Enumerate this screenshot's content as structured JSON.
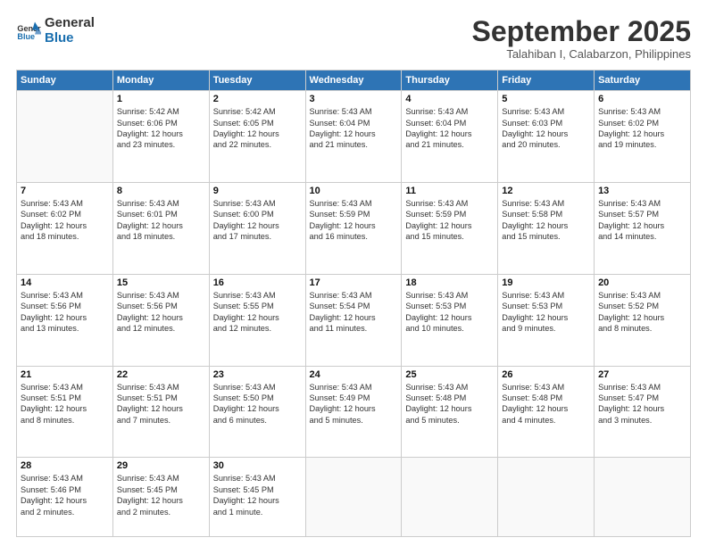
{
  "logo": {
    "line1": "General",
    "line2": "Blue"
  },
  "title": "September 2025",
  "subtitle": "Talahiban I, Calabarzon, Philippines",
  "days": [
    "Sunday",
    "Monday",
    "Tuesday",
    "Wednesday",
    "Thursday",
    "Friday",
    "Saturday"
  ],
  "weeks": [
    [
      {
        "date": "",
        "info": ""
      },
      {
        "date": "1",
        "info": "Sunrise: 5:42 AM\nSunset: 6:06 PM\nDaylight: 12 hours\nand 23 minutes."
      },
      {
        "date": "2",
        "info": "Sunrise: 5:42 AM\nSunset: 6:05 PM\nDaylight: 12 hours\nand 22 minutes."
      },
      {
        "date": "3",
        "info": "Sunrise: 5:43 AM\nSunset: 6:04 PM\nDaylight: 12 hours\nand 21 minutes."
      },
      {
        "date": "4",
        "info": "Sunrise: 5:43 AM\nSunset: 6:04 PM\nDaylight: 12 hours\nand 21 minutes."
      },
      {
        "date": "5",
        "info": "Sunrise: 5:43 AM\nSunset: 6:03 PM\nDaylight: 12 hours\nand 20 minutes."
      },
      {
        "date": "6",
        "info": "Sunrise: 5:43 AM\nSunset: 6:02 PM\nDaylight: 12 hours\nand 19 minutes."
      }
    ],
    [
      {
        "date": "7",
        "info": "Sunrise: 5:43 AM\nSunset: 6:02 PM\nDaylight: 12 hours\nand 18 minutes."
      },
      {
        "date": "8",
        "info": "Sunrise: 5:43 AM\nSunset: 6:01 PM\nDaylight: 12 hours\nand 18 minutes."
      },
      {
        "date": "9",
        "info": "Sunrise: 5:43 AM\nSunset: 6:00 PM\nDaylight: 12 hours\nand 17 minutes."
      },
      {
        "date": "10",
        "info": "Sunrise: 5:43 AM\nSunset: 5:59 PM\nDaylight: 12 hours\nand 16 minutes."
      },
      {
        "date": "11",
        "info": "Sunrise: 5:43 AM\nSunset: 5:59 PM\nDaylight: 12 hours\nand 15 minutes."
      },
      {
        "date": "12",
        "info": "Sunrise: 5:43 AM\nSunset: 5:58 PM\nDaylight: 12 hours\nand 15 minutes."
      },
      {
        "date": "13",
        "info": "Sunrise: 5:43 AM\nSunset: 5:57 PM\nDaylight: 12 hours\nand 14 minutes."
      }
    ],
    [
      {
        "date": "14",
        "info": "Sunrise: 5:43 AM\nSunset: 5:56 PM\nDaylight: 12 hours\nand 13 minutes."
      },
      {
        "date": "15",
        "info": "Sunrise: 5:43 AM\nSunset: 5:56 PM\nDaylight: 12 hours\nand 12 minutes."
      },
      {
        "date": "16",
        "info": "Sunrise: 5:43 AM\nSunset: 5:55 PM\nDaylight: 12 hours\nand 12 minutes."
      },
      {
        "date": "17",
        "info": "Sunrise: 5:43 AM\nSunset: 5:54 PM\nDaylight: 12 hours\nand 11 minutes."
      },
      {
        "date": "18",
        "info": "Sunrise: 5:43 AM\nSunset: 5:53 PM\nDaylight: 12 hours\nand 10 minutes."
      },
      {
        "date": "19",
        "info": "Sunrise: 5:43 AM\nSunset: 5:53 PM\nDaylight: 12 hours\nand 9 minutes."
      },
      {
        "date": "20",
        "info": "Sunrise: 5:43 AM\nSunset: 5:52 PM\nDaylight: 12 hours\nand 8 minutes."
      }
    ],
    [
      {
        "date": "21",
        "info": "Sunrise: 5:43 AM\nSunset: 5:51 PM\nDaylight: 12 hours\nand 8 minutes."
      },
      {
        "date": "22",
        "info": "Sunrise: 5:43 AM\nSunset: 5:51 PM\nDaylight: 12 hours\nand 7 minutes."
      },
      {
        "date": "23",
        "info": "Sunrise: 5:43 AM\nSunset: 5:50 PM\nDaylight: 12 hours\nand 6 minutes."
      },
      {
        "date": "24",
        "info": "Sunrise: 5:43 AM\nSunset: 5:49 PM\nDaylight: 12 hours\nand 5 minutes."
      },
      {
        "date": "25",
        "info": "Sunrise: 5:43 AM\nSunset: 5:48 PM\nDaylight: 12 hours\nand 5 minutes."
      },
      {
        "date": "26",
        "info": "Sunrise: 5:43 AM\nSunset: 5:48 PM\nDaylight: 12 hours\nand 4 minutes."
      },
      {
        "date": "27",
        "info": "Sunrise: 5:43 AM\nSunset: 5:47 PM\nDaylight: 12 hours\nand 3 minutes."
      }
    ],
    [
      {
        "date": "28",
        "info": "Sunrise: 5:43 AM\nSunset: 5:46 PM\nDaylight: 12 hours\nand 2 minutes."
      },
      {
        "date": "29",
        "info": "Sunrise: 5:43 AM\nSunset: 5:45 PM\nDaylight: 12 hours\nand 2 minutes."
      },
      {
        "date": "30",
        "info": "Sunrise: 5:43 AM\nSunset: 5:45 PM\nDaylight: 12 hours\nand 1 minute."
      },
      {
        "date": "",
        "info": ""
      },
      {
        "date": "",
        "info": ""
      },
      {
        "date": "",
        "info": ""
      },
      {
        "date": "",
        "info": ""
      }
    ]
  ]
}
